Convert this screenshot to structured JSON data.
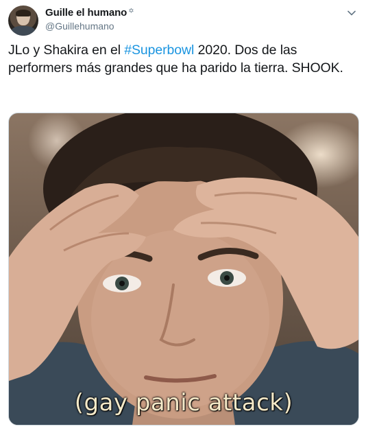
{
  "user": {
    "display_name": "Guille el humano",
    "name_emoji": "✡︎",
    "handle": "@Guillehumano"
  },
  "tweet": {
    "text_before": "JLo y Shakira en el ",
    "hashtag": "#Superbowl",
    "text_after": " 2020. Dos de las performers más grandes que ha parido la tierra. SHOOK."
  },
  "media": {
    "caption": "(gay panic attack)"
  },
  "icons": {
    "caret": "chevron-down-icon"
  },
  "colors": {
    "text": "#14171a",
    "secondary": "#657786",
    "link": "#1b95e0",
    "border": "#ccd6dd"
  }
}
